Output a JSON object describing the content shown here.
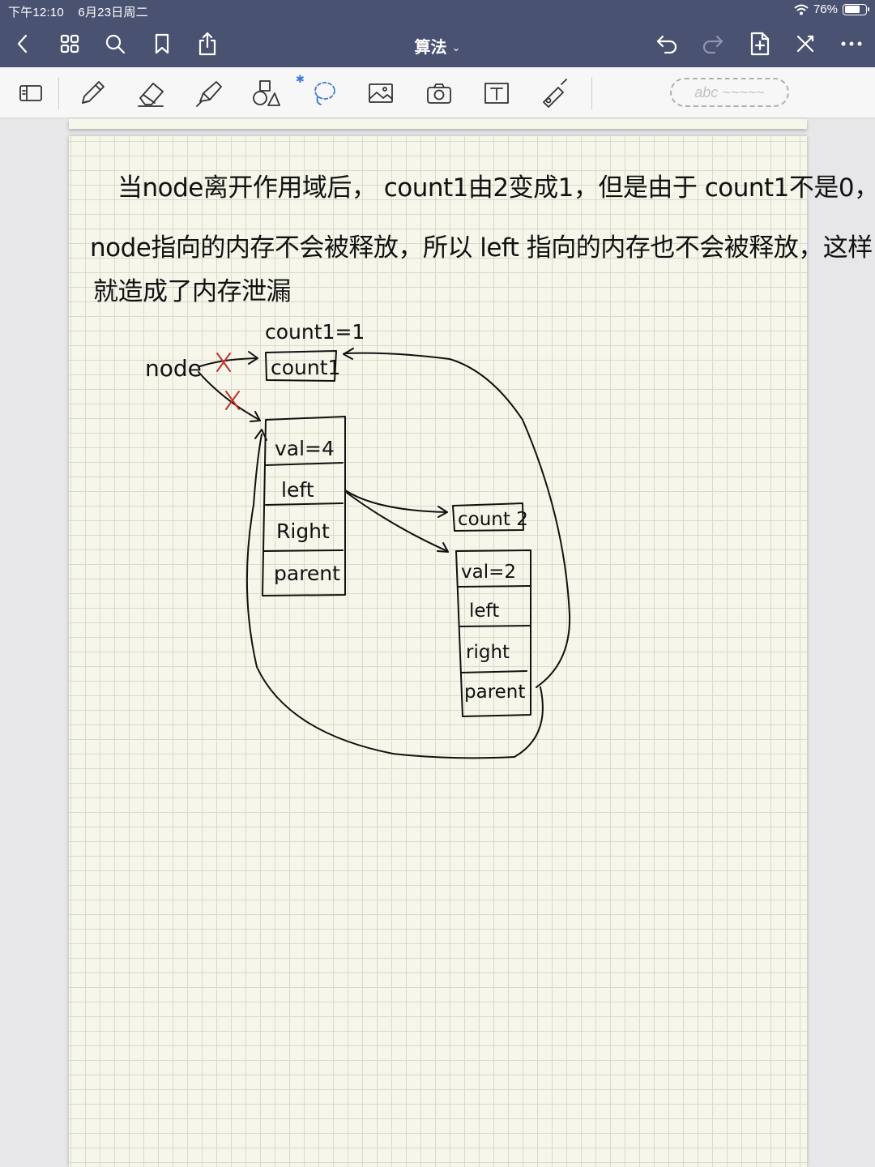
{
  "status": {
    "time": "下午12:10",
    "date": "6月23日周二",
    "battery": "76%",
    "battery_level": 0.76
  },
  "nav": {
    "title": "算法"
  },
  "toolbar": {
    "convert_placeholder": "abc ~~~~~"
  },
  "note": {
    "line1": "当node离开作用域后， count1由2变成1，但是由于 count1不是0，",
    "line2": "node指向的内存不会被释放，所以 left 指向的内存也不会被释放，这样",
    "line3": "就造成了内存泄漏",
    "diagram": {
      "node_label": "node",
      "count1_caption": "count1=1",
      "count1_box": "count1",
      "obj1_fields": [
        "val=4",
        "left",
        "Right",
        "parent"
      ],
      "count2_box": "count 2",
      "obj2_fields": [
        "val=2",
        "left",
        "right",
        "parent"
      ]
    }
  },
  "colors": {
    "topbar": "#4a5272",
    "paper": "#f7f6ea",
    "grid": "#d8dbc9",
    "ink": "#111111",
    "cross": "#c2302a",
    "bluetooth": "#3a78d8"
  },
  "icons": [
    "back-icon",
    "grid-icon",
    "search-icon",
    "bookmark-icon",
    "share-icon",
    "undo-icon",
    "redo-icon",
    "add-page-icon",
    "close-edit-icon",
    "more-icon",
    "layout-icon",
    "pen-icon",
    "eraser-icon",
    "highlighter-icon",
    "shapes-icon",
    "bluetooth-icon",
    "lasso-icon",
    "image-icon",
    "camera-icon",
    "textbox-icon",
    "laser-icon"
  ]
}
